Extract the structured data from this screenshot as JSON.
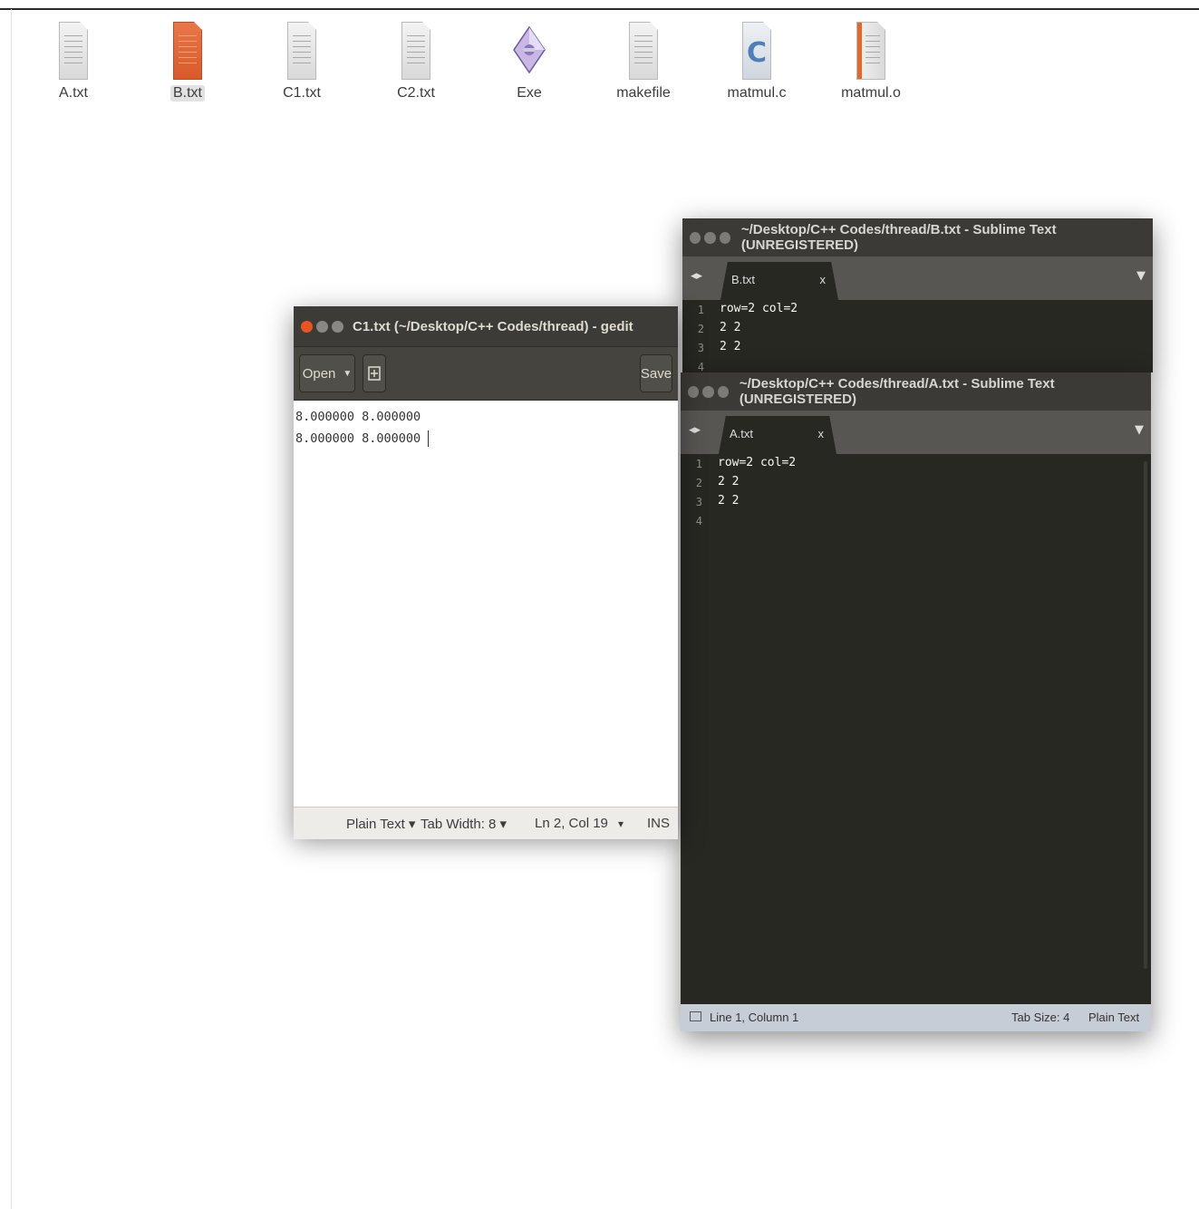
{
  "desktop": {
    "files": [
      {
        "name": "A.txt",
        "icon": "text-file-icon"
      },
      {
        "name": "B.txt",
        "icon": "text-file-icon",
        "selected": true
      },
      {
        "name": "C1.txt",
        "icon": "text-file-icon"
      },
      {
        "name": "C2.txt",
        "icon": "text-file-icon"
      },
      {
        "name": "Exe",
        "icon": "executable-icon"
      },
      {
        "name": "makefile",
        "icon": "text-file-icon"
      },
      {
        "name": "matmul.c",
        "icon": "c-source-icon"
      },
      {
        "name": "matmul.o",
        "icon": "object-file-icon"
      }
    ]
  },
  "gedit": {
    "title": "C1.txt (~/Desktop/C++ Codes/thread) - gedit",
    "open_label": "Open",
    "save_label": "Save",
    "lines": [
      "8.000000 8.000000",
      "8.000000 8.000000 "
    ],
    "status": {
      "language": "Plain Text ▾",
      "tab_width": "Tab Width: 8 ▾",
      "position": "Ln 2, Col 19",
      "dropdown": "▾",
      "mode": "INS"
    }
  },
  "sublime_b": {
    "title": "~/Desktop/C++ Codes/thread/B.txt - Sublime Text (UNREGISTERED)",
    "tab": "B.txt",
    "close": "x",
    "line_numbers": [
      "1",
      "2",
      "3",
      "4"
    ],
    "lines": [
      "row=2 col=2",
      "2 2",
      "2 2",
      ""
    ]
  },
  "sublime_a": {
    "title": "~/Desktop/C++ Codes/thread/A.txt - Sublime Text (UNREGISTERED)",
    "tab": "A.txt",
    "close": "x",
    "line_numbers": [
      "1",
      "2",
      "3",
      "4"
    ],
    "lines": [
      "row=2 col=2",
      "2 2",
      "2 2",
      ""
    ],
    "status": {
      "cursor": "Line 1, Column 1",
      "tab_size": "Tab Size: 4",
      "syntax": "Plain Text"
    }
  },
  "colors": {
    "close_button": "#e95420",
    "titlebar": "#3c3b37",
    "sublime_bg": "#272822"
  }
}
